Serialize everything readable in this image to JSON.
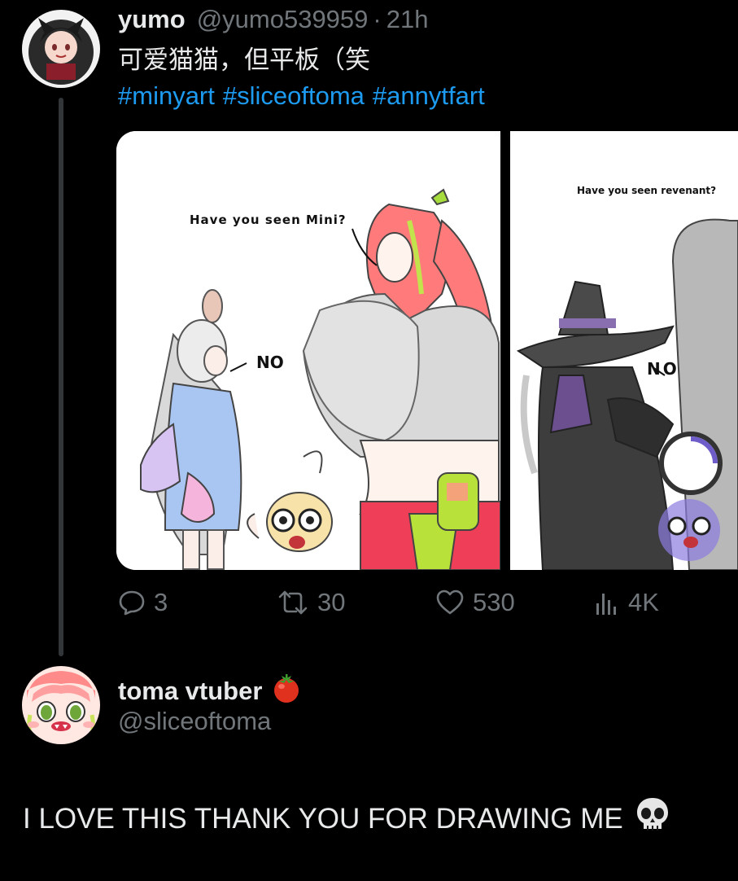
{
  "tweet": {
    "author_name": "yumo",
    "author_handle": "@yumo539959",
    "separator": "·",
    "time": "21h",
    "text": "可爱猫猫，但平板（笑",
    "hashtags": [
      "#minyart",
      "#sliceoftoma",
      "#annytfart"
    ],
    "images": [
      {
        "bubble_main": "Have you seen Mini?",
        "bubble_reply": "NO"
      },
      {
        "bubble_main": "Have you seen revenant?",
        "bubble_reply": "NO"
      }
    ],
    "stats": {
      "replies": "3",
      "retweets": "30",
      "likes": "530",
      "views": "4K"
    }
  },
  "reply": {
    "author_name": "toma vtuber",
    "name_emoji": "tomato",
    "author_handle": "@sliceoftoma",
    "text": "I LOVE THIS THANK YOU FOR DRAWING ME",
    "text_emoji": "skull"
  },
  "colors": {
    "background": "#000000",
    "text": "#e7e9ea",
    "muted": "#71767b",
    "link": "#1d9bf0",
    "thread_line": "#333639"
  }
}
